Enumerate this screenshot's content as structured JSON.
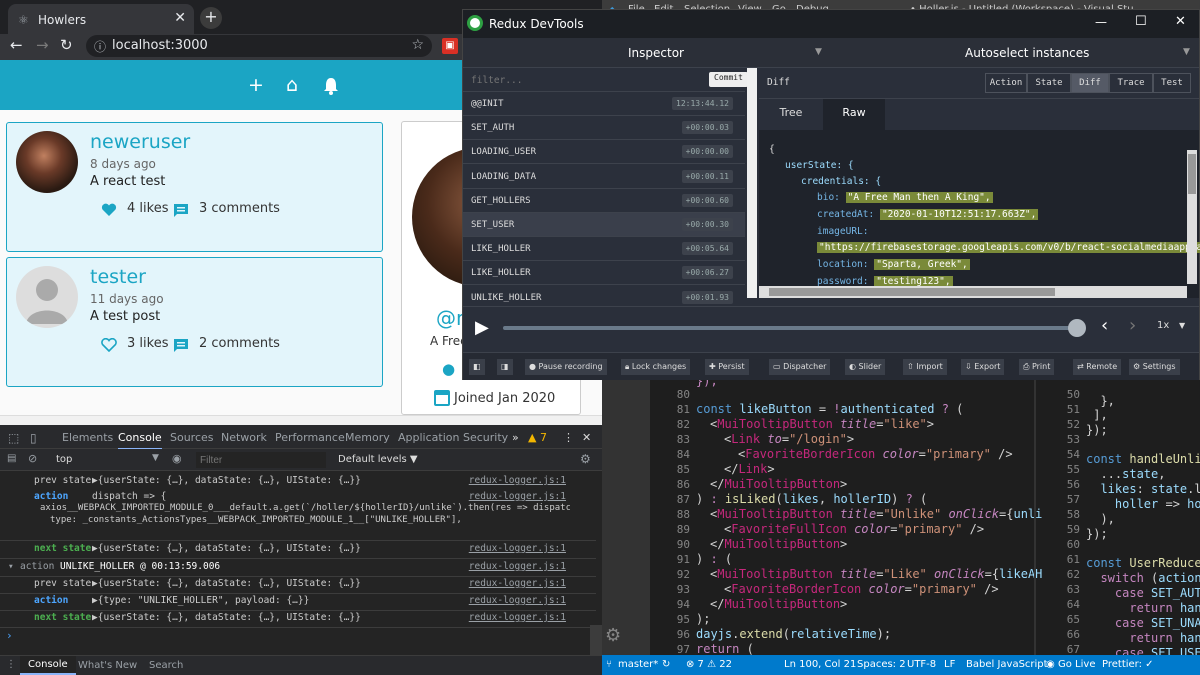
{
  "browser": {
    "tab_title": "Howlers",
    "url": "localhost:3000"
  },
  "app": {
    "posts": [
      {
        "username": "neweruser",
        "date": "8 days ago",
        "body": "A react test",
        "likes": "4 likes",
        "comments": "3 comments",
        "liked": true
      },
      {
        "username": "tester",
        "date": "11 days ago",
        "body": "A test post",
        "likes": "3 likes",
        "comments": "2 comments",
        "liked": false
      }
    ],
    "profile": {
      "handle": "@n",
      "bio": "A Free",
      "joined": "Joined Jan 2020"
    }
  },
  "devtools": {
    "tabs": [
      "Elements",
      "Console",
      "Sources",
      "Network",
      "Performance",
      "Memory",
      "Application",
      "Security"
    ],
    "active_tab": "Console",
    "warnings": "7",
    "context": "top",
    "filter_placeholder": "Filter",
    "levels": "Default levels ▼",
    "log": [
      {
        "label": "prev state",
        "text": "▶{userState: {…}, dataState: {…}, UIState: {…}}",
        "src": "redux-logger.js:1"
      },
      {
        "label": "action",
        "text": "dispatch => {",
        "src": "redux-logger.js:1"
      },
      {
        "label": "",
        "text": "axios__WEBPACK_IMPORTED_MODULE_0___default.a.get(`/holler/${hollerID}/unlike`).then(res => dispatch({",
        "src": ""
      },
      {
        "label": "",
        "text": "type: _constants_ActionsTypes__WEBPACK_IMPORTED_MODULE_1__[\"UNLIKE_HOLLER\"],",
        "src": ""
      },
      {
        "label": "next state",
        "text": "▶{userState: {…}, dataState: {…}, UIState: {…}}",
        "src": "redux-logger.js:1"
      },
      {
        "label": "action",
        "text": "UNLIKE_HOLLER @ 00:13:59.006",
        "src": "redux-logger.js:1"
      },
      {
        "label": "prev state",
        "text": "▶{userState: {…}, dataState: {…}, UIState: {…}}",
        "src": "redux-logger.js:1"
      },
      {
        "label": "action",
        "text": "▶{type: \"UNLIKE_HOLLER\", payload: {…}}",
        "src": "redux-logger.js:1"
      },
      {
        "label": "next state",
        "text": "▶{userState: {…}, dataState: {…}, UIState: {…}}",
        "src": "redux-logger.js:1"
      }
    ],
    "bottom_tabs": [
      "Console",
      "What's New",
      "Search"
    ]
  },
  "vscode": {
    "menu": [
      "File",
      "Edit",
      "Selection",
      "View",
      "Go",
      "Debug",
      "..."
    ],
    "title": "• Holler.js - Untitled (Workspace) - Visual Stu",
    "left_lines": [
      "80",
      "81",
      "82",
      "83",
      "84",
      "85",
      "86",
      "87",
      "88",
      "89",
      "90",
      "91",
      "92",
      "93",
      "94",
      "95",
      "96",
      "97"
    ],
    "right_lines": [
      "50",
      "51",
      "52",
      "53",
      "54",
      "55",
      "56",
      "57",
      "58",
      "59",
      "60",
      "61",
      "62",
      "63",
      "64",
      "65",
      "66",
      "67"
    ],
    "status": {
      "branch": "master*",
      "errors": "⊗ 7 ⚠ 22",
      "position": "Ln 100, Col 21",
      "spaces": "Spaces: 2",
      "encoding": "UTF-8",
      "eol": "LF",
      "language": "Babel JavaScript",
      "golive": "Go Live",
      "prettier": "Prettier: ✓"
    }
  },
  "redux": {
    "title": "Redux DevTools",
    "inspector": "Inspector",
    "instances": "Autoselect instances",
    "filter_placeholder": "filter...",
    "commit": "Commit",
    "pane_label": "Diff",
    "tabs": [
      "Action",
      "State",
      "Diff",
      "Trace",
      "Test"
    ],
    "active_tab": "Diff",
    "subtabs": [
      "Tree",
      "Raw"
    ],
    "actions": [
      {
        "name": "@@INIT",
        "time": "12:13:44.12"
      },
      {
        "name": "SET_AUTH",
        "time": "+00:00.03"
      },
      {
        "name": "LOADING_USER",
        "time": "+00:00.00"
      },
      {
        "name": "LOADING_DATA",
        "time": "+00:00.11"
      },
      {
        "name": "GET_HOLLERS",
        "time": "+00:00.60"
      },
      {
        "name": "SET_USER",
        "time": "+00:00.30"
      },
      {
        "name": "LIKE_HOLLER",
        "time": "+00:05.64"
      },
      {
        "name": "LIKE_HOLLER",
        "time": "+00:06.27"
      },
      {
        "name": "UNLIKE_HOLLER",
        "time": "+00:01.93"
      }
    ],
    "json": {
      "open": "{",
      "userState": "userState: {",
      "credentials": "credentials: {",
      "bio_key": "bio:",
      "bio": "\"A Free Man then A King\",",
      "created_key": "createdAt:",
      "created": "\"2020-01-10T12:51:17.663Z\",",
      "image_key": "imageURL:",
      "image": "\"https://firebasestorage.googleapis.com/v0/b/react-socialmediaapp.appspot",
      "loc_key": "location:",
      "loc": "\"Sparta, Greek\",",
      "pw_key": "password:",
      "pw": "\"testing123\","
    },
    "speed": "1x",
    "footer": [
      "Pause recording",
      "Lock changes",
      "Persist",
      "Dispatcher",
      "Slider",
      "Import",
      "Export",
      "Print",
      "Remote",
      "Settings"
    ]
  }
}
